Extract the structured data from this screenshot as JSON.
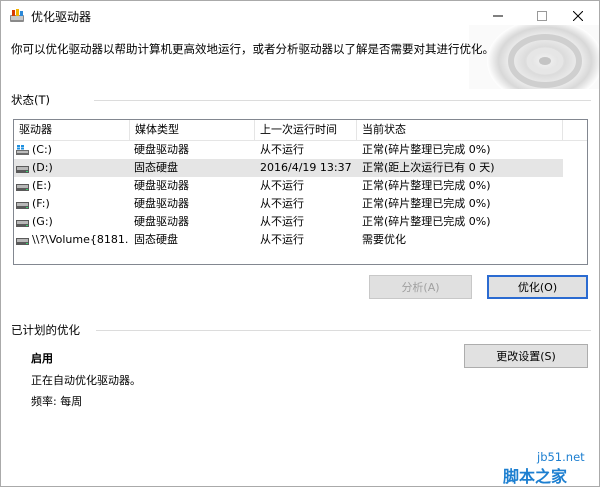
{
  "window": {
    "title": "优化驱动器"
  },
  "description": "你可以优化驱动器以帮助计算机更高效地运行，或者分析驱动器以了解是否需要对其进行优化。",
  "status_section": {
    "title": "状态(T)"
  },
  "table": {
    "headers": {
      "drive": "驱动器",
      "media": "媒体类型",
      "last_run": "上一次运行时间",
      "status": "当前状态"
    },
    "rows": [
      {
        "drive": "(C:)",
        "media": "硬盘驱动器",
        "last_run": "从不运行",
        "status": "正常(碎片整理已完成 0%)",
        "icon": "windows-drive-icon"
      },
      {
        "drive": "(D:)",
        "media": "固态硬盘",
        "last_run": "2016/4/19 13:37",
        "status": "正常(距上次运行已有 0 天)",
        "icon": "drive-icon"
      },
      {
        "drive": "(E:)",
        "media": "硬盘驱动器",
        "last_run": "从不运行",
        "status": "正常(碎片整理已完成 0%)",
        "icon": "drive-icon"
      },
      {
        "drive": "(F:)",
        "media": "硬盘驱动器",
        "last_run": "从不运行",
        "status": "正常(碎片整理已完成 0%)",
        "icon": "drive-icon"
      },
      {
        "drive": "(G:)",
        "media": "硬盘驱动器",
        "last_run": "从不运行",
        "status": "正常(碎片整理已完成 0%)",
        "icon": "drive-icon"
      },
      {
        "drive": "\\\\?\\Volume{8181...",
        "media": "固态硬盘",
        "last_run": "从不运行",
        "status": "需要优化",
        "icon": "drive-icon"
      }
    ]
  },
  "buttons": {
    "analyze": "分析(A)",
    "optimize": "优化(O)",
    "change_settings": "更改设置(S)"
  },
  "scheduled": {
    "title": "已计划的优化",
    "state": "启用",
    "detail": "正在自动优化驱动器。",
    "frequency": "频率: 每周"
  },
  "watermark": {
    "site": "jb51.net",
    "logo": "脚本之家"
  },
  "colors": {
    "accent": "#2b6bd1",
    "selected_row": "#e5e5e5",
    "watermark": "#1d7fd0"
  }
}
